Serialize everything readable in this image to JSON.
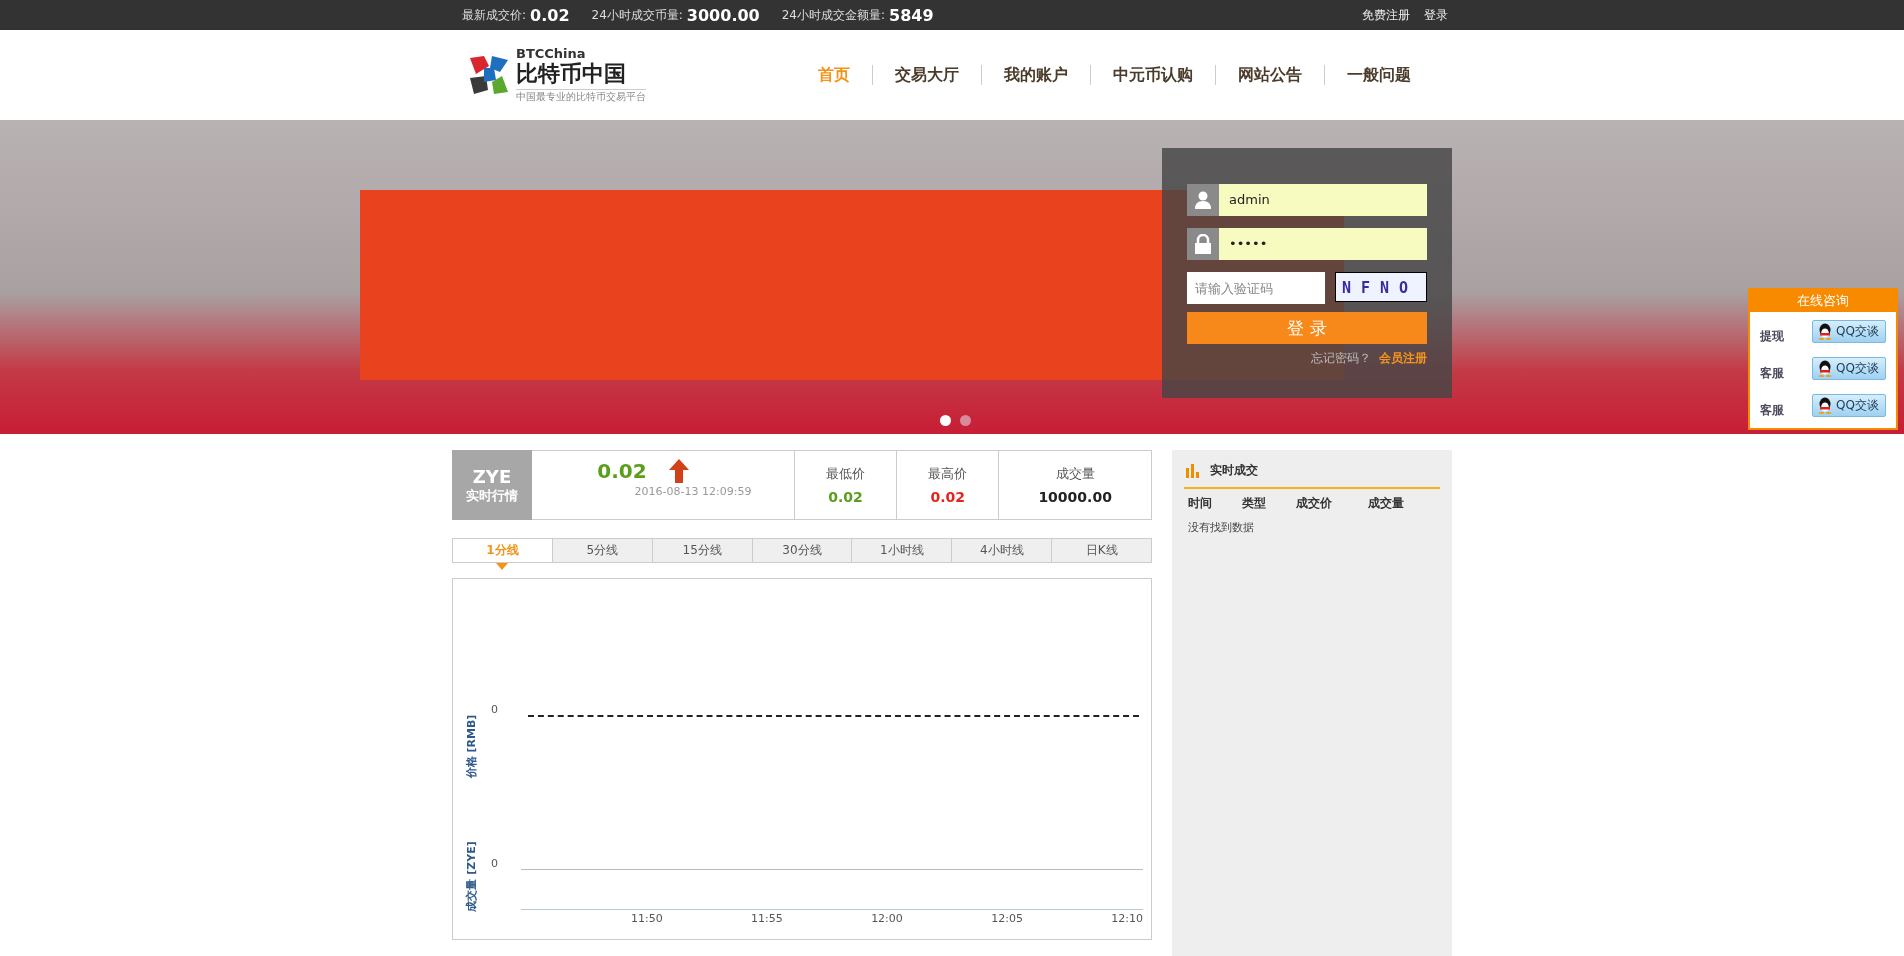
{
  "top_bar": {
    "stats": [
      {
        "label": "最新成交价:",
        "value": "0.02"
      },
      {
        "label": "24小时成交币量:",
        "value": "3000.00"
      },
      {
        "label": "24小时成交金额量:",
        "value": "5849"
      }
    ],
    "links": [
      "免费注册",
      "登录"
    ]
  },
  "header": {
    "logo": {
      "brand": "BTCChina",
      "name": "比特币中国",
      "tagline": "中国最专业的比特币交易平台"
    },
    "nav": [
      {
        "label": "首页",
        "selected": true
      },
      {
        "label": "交易大厅",
        "selected": false
      },
      {
        "label": "我的账户",
        "selected": false
      },
      {
        "label": "中元币认购",
        "selected": false
      },
      {
        "label": "网站公告",
        "selected": false
      },
      {
        "label": "一般问题",
        "selected": false
      }
    ]
  },
  "banner": {
    "slides": [
      {
        "selected": true
      },
      {
        "selected": false
      }
    ],
    "login": {
      "username": "admin",
      "password": "•••••",
      "captcha_placeholder": "请输入验证码",
      "captcha_text": "NFNO",
      "submit": "登 录",
      "forgot": "忘记密码？",
      "register": "会员注册"
    }
  },
  "online_consult": {
    "title": "在线咨询",
    "rows": [
      {
        "label": "提现",
        "button": "QQ交谈"
      },
      {
        "label": "客服",
        "button": "QQ交谈"
      },
      {
        "label": "客服",
        "button": "QQ交谈"
      }
    ]
  },
  "market": {
    "symbol": "ZYE",
    "caption": "实时行情",
    "price": "0.02",
    "price_rising": true,
    "time": "2016-08-13 12:09:59",
    "stats": [
      {
        "label": "最低价",
        "value": "0.02",
        "color": "#5a9e1a"
      },
      {
        "label": "最高价",
        "value": "0.02",
        "color": "#e8221a"
      },
      {
        "label": "成交量",
        "value": "10000.00",
        "color": "#222222"
      }
    ]
  },
  "period_tabs": [
    {
      "label": "1分线",
      "selected": true
    },
    {
      "label": "5分线",
      "selected": false
    },
    {
      "label": "15分线",
      "selected": false
    },
    {
      "label": "30分线",
      "selected": false
    },
    {
      "label": "1小时线",
      "selected": false
    },
    {
      "label": "4小时线",
      "selected": false
    },
    {
      "label": "日K线",
      "selected": false
    }
  ],
  "chart": {
    "price_axis_label": "价格 [RMB]",
    "price_tick": "0",
    "volume_axis_label": "成交量 [ZYE]",
    "volume_tick": "0",
    "time_ticks": [
      "11:50",
      "11:55",
      "12:00",
      "12:05",
      "12:10"
    ]
  },
  "trades_panel": {
    "title": "实时成交",
    "columns": [
      "时间",
      "类型",
      "成交价",
      "成交量"
    ],
    "empty_message": "没有找到数据"
  }
}
